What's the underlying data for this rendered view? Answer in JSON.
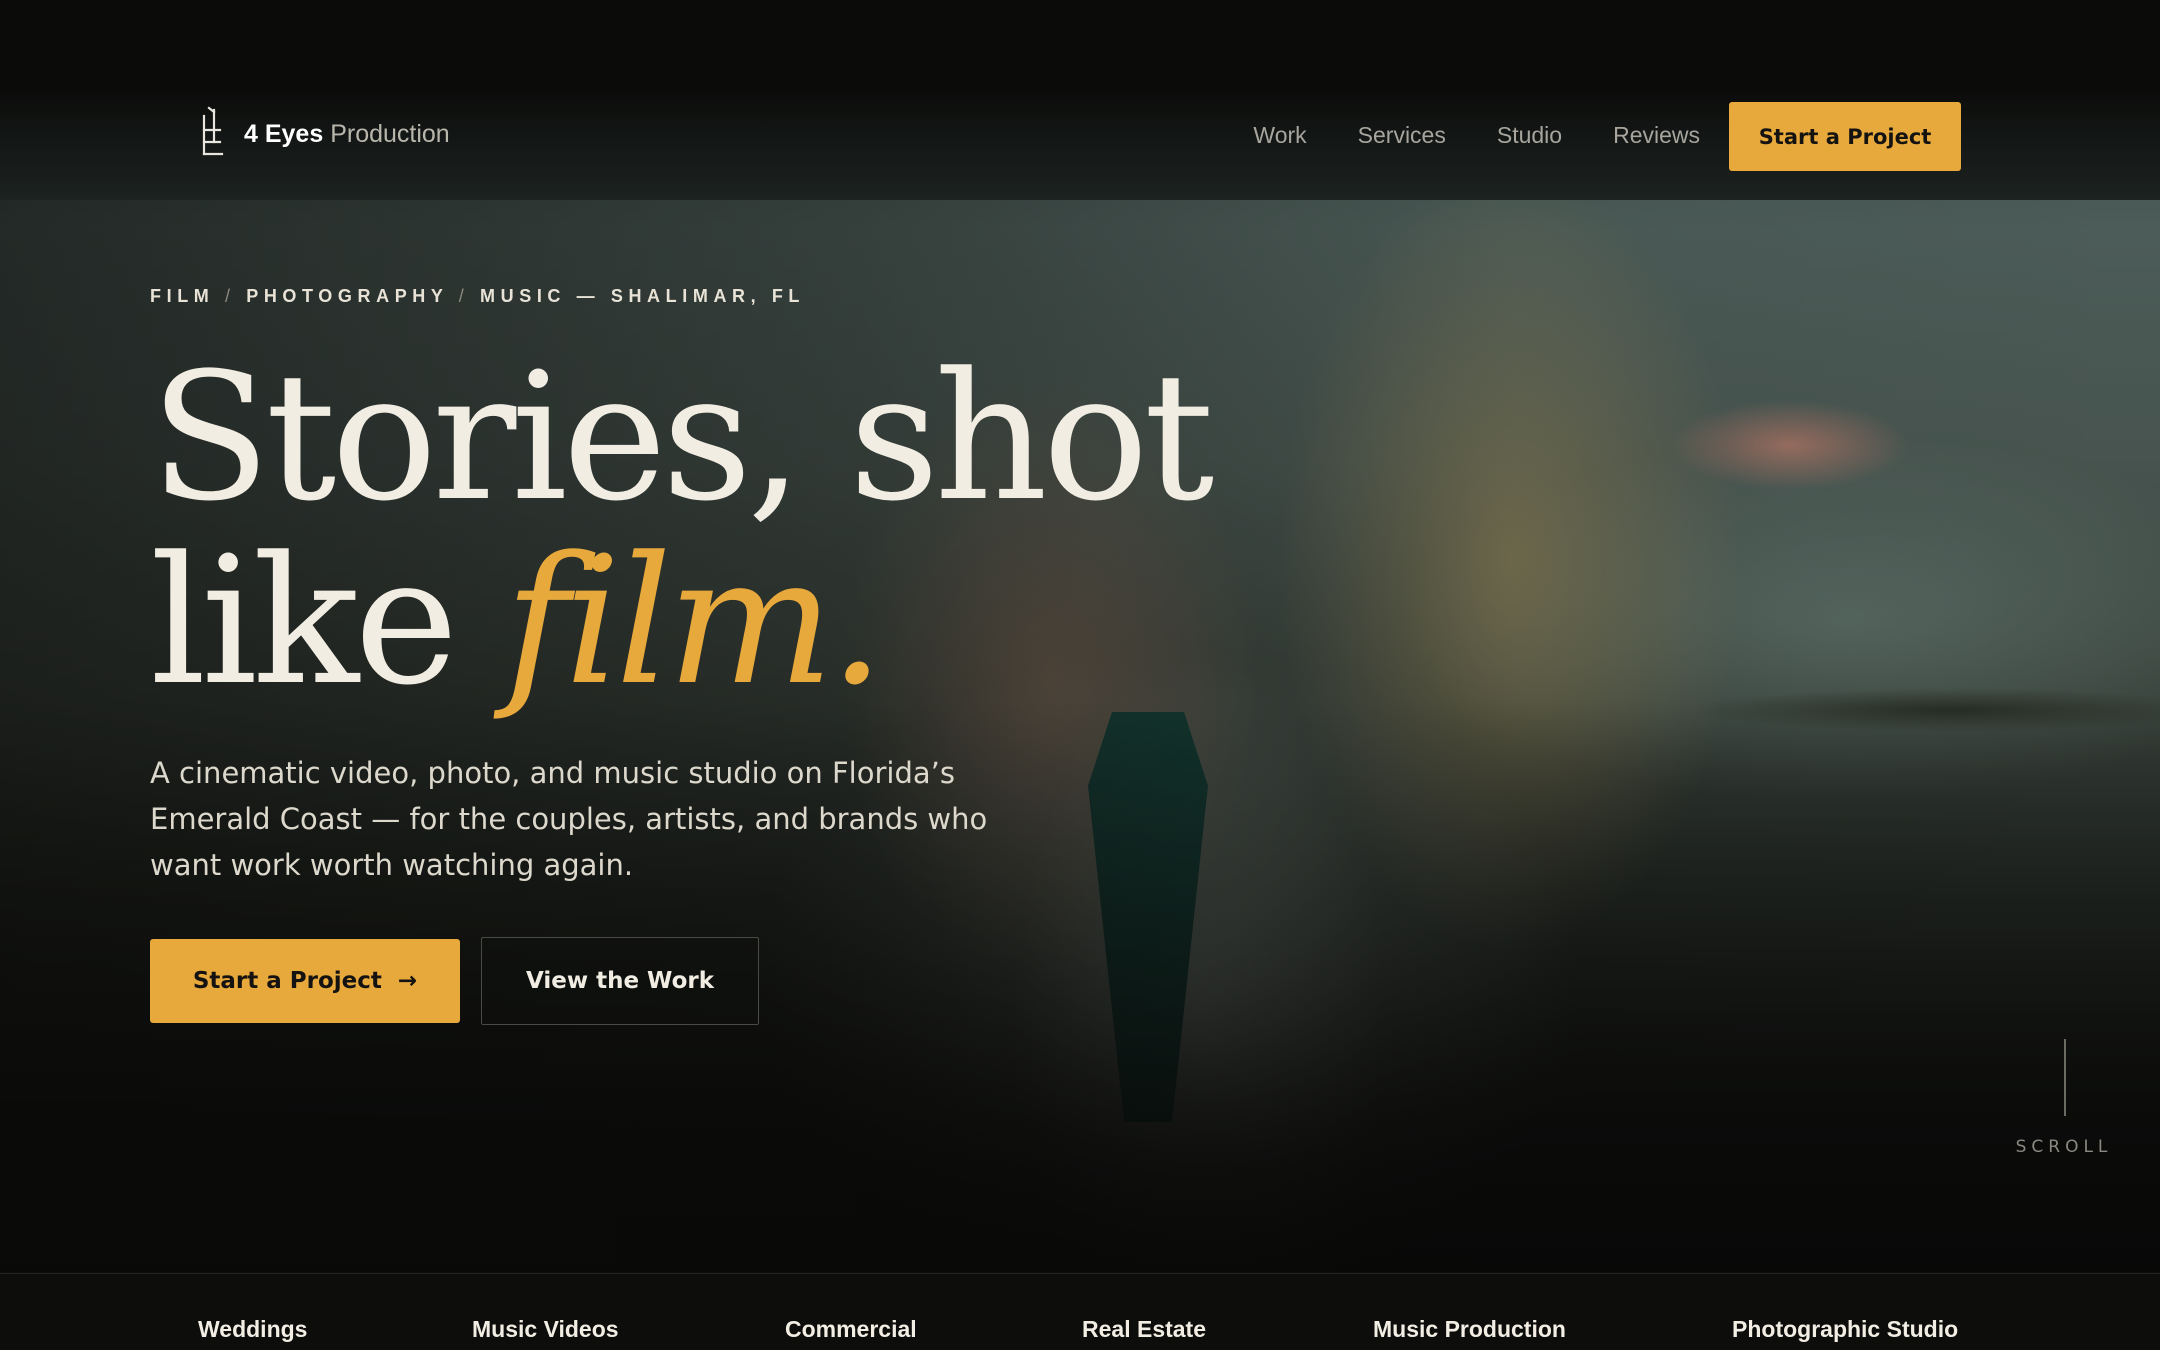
{
  "brand": {
    "name_strong": "4 Eyes",
    "name_rest": " Production",
    "logo_icon": "ladder-e-icon"
  },
  "nav": {
    "items": [
      {
        "label": "Work"
      },
      {
        "label": "Services"
      },
      {
        "label": "Studio"
      },
      {
        "label": "Reviews"
      }
    ],
    "cta_label": "Start a Project"
  },
  "hero": {
    "eyebrow": {
      "parts": [
        "FILM",
        "PHOTOGRAPHY",
        "MUSIC"
      ],
      "separator": "/",
      "dash": "—",
      "location": "SHALIMAR, FL"
    },
    "title_line1": "Stories, shot",
    "title_line2_prefix": "like ",
    "title_accent": "film.",
    "description": "A cinematic video, photo, and music studio on Florida’s Emerald Coast — for the couples, artists, and brands who want work worth watching again.",
    "primary_button": "Start a Project",
    "primary_arrow": "→",
    "secondary_button": "View the Work",
    "scroll_label": "SCROLL",
    "background_image": "couple-embrace-beach-photo"
  },
  "services": [
    {
      "label": "Weddings"
    },
    {
      "label": "Music Videos"
    },
    {
      "label": "Commercial"
    },
    {
      "label": "Real Estate"
    },
    {
      "label": "Music Production"
    },
    {
      "label": "Photographic Studio"
    }
  ],
  "colors": {
    "accent": "#e8a93c",
    "background": "#0b0b0a",
    "text_primary": "#f1ede2",
    "text_muted": "#a7a59e"
  }
}
